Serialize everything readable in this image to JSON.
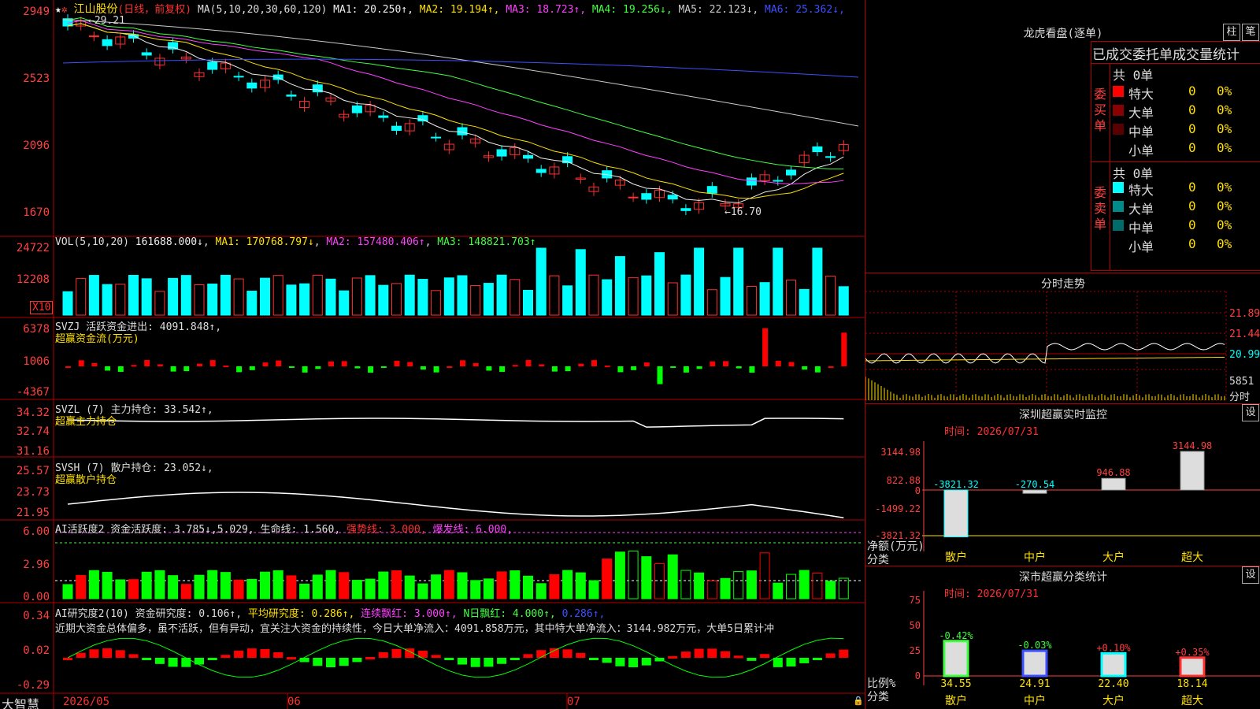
{
  "stock": {
    "name": "江山股份",
    "period": "(日线，前复权)"
  },
  "main": {
    "axis": [
      "2949",
      "2523",
      "2096",
      "1670"
    ],
    "ma_label": "MA(5,10,20,30,60,120)",
    "ma": [
      {
        "k": "MA1: 20.250↑",
        "color": "#eeeeee"
      },
      {
        "k": "MA2: 19.194↑",
        "color": "#ffe000"
      },
      {
        "k": "MA3: 18.723↑",
        "color": "#ff40ff"
      },
      {
        "k": "MA4: 19.256↓",
        "color": "#40ff40"
      },
      {
        "k": "MA5: 22.123↓",
        "color": "#cccccc"
      },
      {
        "k": "MA6: 25.362↓",
        "color": "#3c50ff"
      }
    ],
    "hi": "29.21",
    "lo": "16.70"
  },
  "vol": {
    "axis": [
      "24722",
      "12208"
    ],
    "unit": "X10",
    "label": "VOL(5,10,20)",
    "val": "161688.000↓",
    "ma1": "MA1: 170768.797↓",
    "ma2": "MA2: 157480.406↑",
    "ma3": "MA3: 148821.703↑"
  },
  "svzj": {
    "axis": [
      "6378",
      "1006",
      "-4367"
    ],
    "label": "SVZJ  活跃资金进出: 4091.848↑,",
    "sub": "超赢资金流(万元)"
  },
  "svzl": {
    "axis": [
      "34.32",
      "32.74",
      "31.16"
    ],
    "label": "SVZL (7) 主力持仓: 33.542↑,",
    "sub": "超赢主力持仓"
  },
  "svsh": {
    "axis": [
      "25.57",
      "23.73",
      "21.95"
    ],
    "label": "SVSH (7) 散户持仓: 23.052↓,",
    "sub": "超赢散户持仓"
  },
  "ai1": {
    "axis": [
      "6.00",
      "2.96",
      "0.00"
    ],
    "a": "AI活跃度2 资金活跃度: 3.785↓,5.029,",
    "b": "生命线: 1.560,",
    "c": "强势线: 3.000,",
    "d": "爆发线: 6.000,"
  },
  "ai2": {
    "axis": [
      "0.34",
      "0.02",
      "-0.29"
    ],
    "a": "AI研究度2(10) 资金研究度: 0.106↑,",
    "b": "平均研究度: 0.286↑,",
    "c": "连续飘红: 3.000↑,",
    "d": "N日飘红: 4.000↑,",
    "e": "0.286↑,",
    "text": "近期大资金总体偏多，虽不活跃，但有异动，宜关注大资金的持续性，今日大单净流入：4091.858万元，其中特大单净流入：3144.982万元，大单5日累计冲"
  },
  "dates": [
    "2026/05",
    "06",
    "07"
  ],
  "brand": "大智慧",
  "right": {
    "title": "龙虎看盘(逐单)",
    "btn1": "柱",
    "btn2": "笔",
    "heading": "已成交委托单成交量统计",
    "buy": {
      "side": "委买单",
      "total": "共 0单",
      "rows": [
        {
          "n": "特大",
          "v": "0",
          "p": "0%",
          "c": "#ff0000"
        },
        {
          "n": "大单",
          "v": "0",
          "p": "0%",
          "c": "#8b0000"
        },
        {
          "n": "中单",
          "v": "0",
          "p": "0%",
          "c": "#5a0000"
        },
        {
          "n": "小单",
          "v": "0",
          "p": "0%",
          "c": "#000000"
        }
      ]
    },
    "sell": {
      "side": "委卖单",
      "total": "共 0单",
      "rows": [
        {
          "n": "特大",
          "v": "0",
          "p": "0%",
          "c": "#00ffff"
        },
        {
          "n": "大单",
          "v": "0",
          "p": "0%",
          "c": "#008b8b"
        },
        {
          "n": "中单",
          "v": "0",
          "p": "0%",
          "c": "#006b6b"
        },
        {
          "n": "小单",
          "v": "0",
          "p": "0%",
          "c": "#000000"
        }
      ]
    },
    "intraday": {
      "title": "分时走势",
      "y": [
        "21.89",
        "21.44",
        "20.99"
      ],
      "vol": "5851",
      "unit": "分时"
    },
    "sz": {
      "title": "深圳超赢实时监控",
      "btn": "设",
      "time": "时间: 2026/07/31",
      "ylab": [
        "3144.98",
        "822.88",
        "0",
        "-1499.22",
        "-3821.32"
      ],
      "vals": [
        "-3821.32",
        "-270.54",
        "946.88",
        "3144.98"
      ],
      "cats": [
        "散户",
        "中户",
        "大户",
        "超大"
      ],
      "foot1": "净额(万元)",
      "foot2": "分类"
    },
    "sc": {
      "title": "深市超赢分类统计",
      "btn": "设",
      "time": "时间: 2026/07/31",
      "ylab": [
        "75",
        "50",
        "25",
        "0"
      ],
      "pct": [
        "-0.42%",
        "-0.03%",
        "+0.10%",
        "+0.35%"
      ],
      "vals": [
        "34.55",
        "24.91",
        "22.40",
        "18.14"
      ],
      "cats": [
        "散户",
        "中户",
        "大户",
        "超大"
      ],
      "foot1": "比例%",
      "foot2": "分类"
    }
  },
  "chart_data": [
    {
      "type": "bar",
      "title": "深圳超赢实时监控",
      "categories": [
        "散户",
        "中户",
        "大户",
        "超大"
      ],
      "values": [
        -3821.32,
        -270.54,
        946.88,
        3144.98
      ],
      "ylabel": "净额(万元)",
      "ylim": [
        -3821.32,
        3144.98
      ]
    },
    {
      "type": "bar",
      "title": "深市超赢分类统计",
      "categories": [
        "散户",
        "中户",
        "大户",
        "超大"
      ],
      "values": [
        34.55,
        24.91,
        22.4,
        18.14
      ],
      "ylabel": "比例%",
      "ylim": [
        0,
        75
      ]
    }
  ]
}
